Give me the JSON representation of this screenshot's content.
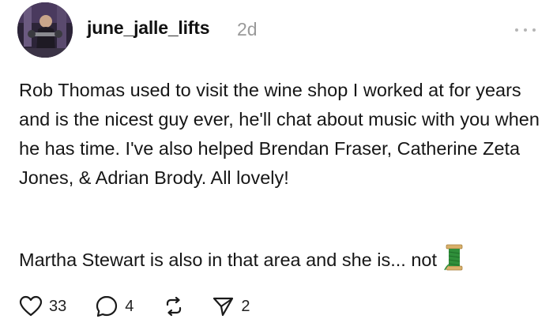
{
  "post": {
    "username": "june_jalle_lifts",
    "timestamp": "2d",
    "paragraph1": "Rob Thomas used to visit the wine shop I worked at for years and is the nicest guy ever, he'll chat about music with you when he has time. I've also helped Brendan Fraser, Catherine Zeta Jones, & Adrian Brody. All lovely!",
    "paragraph2": "Martha Stewart is also in that area and she is... not",
    "emoji_icon": "thread-spool-icon"
  },
  "actions": {
    "like_count": "33",
    "comment_count": "4",
    "share_count": "2"
  },
  "icons": {
    "like": "heart-icon",
    "comment": "comment-bubble-icon",
    "repost": "repost-icon",
    "share": "send-icon",
    "more": "more-options-icon"
  },
  "colors": {
    "text": "#161616",
    "muted": "#9a9a9a",
    "spool_thread": "#2f8f3a",
    "spool_wood": "#d9b06a"
  }
}
